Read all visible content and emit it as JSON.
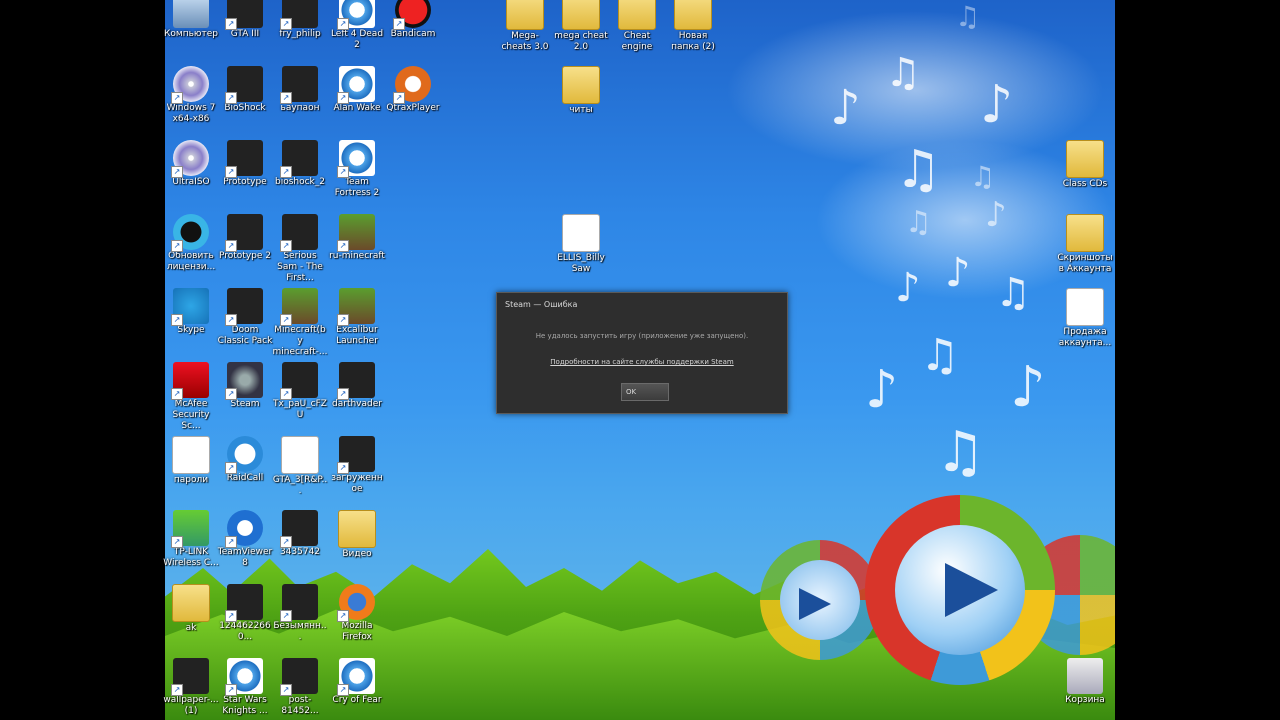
{
  "icons": [
    {
      "label": "Компьютер",
      "icon": "computer-icon"
    },
    {
      "label": "GTA III",
      "icon": "game-icon"
    },
    {
      "label": "fry_philip",
      "icon": "image-icon"
    },
    {
      "label": "Left 4 Dead 2",
      "icon": "internet-shortcut-icon"
    },
    {
      "label": "Bandicam",
      "icon": "bandicam-icon"
    },
    {
      "label": "Mega-cheats 3.0",
      "icon": "folder-icon"
    },
    {
      "label": "mega cheat 2.0",
      "icon": "folder-icon"
    },
    {
      "label": "Cheat engine",
      "icon": "folder-icon"
    },
    {
      "label": "Новая папка (2)",
      "icon": "folder-icon"
    },
    {
      "label": "Windows 7 x64-x86",
      "icon": "disc-icon"
    },
    {
      "label": "BioShock",
      "icon": "game-icon"
    },
    {
      "label": "ьаупаон",
      "icon": "image-icon"
    },
    {
      "label": "Alan Wake",
      "icon": "internet-shortcut-icon"
    },
    {
      "label": "QtraxPlayer",
      "icon": "qtrax-icon"
    },
    {
      "label": "читы",
      "icon": "folder-icon"
    },
    {
      "label": "UltraISO",
      "icon": "disc-icon"
    },
    {
      "label": "Prototype",
      "icon": "game-icon"
    },
    {
      "label": "bioshock_2",
      "icon": "image-icon"
    },
    {
      "label": "Team Fortress 2",
      "icon": "internet-shortcut-icon"
    },
    {
      "label": "Class CDs",
      "icon": "folder-icon"
    },
    {
      "label": "Обновить лицензи...",
      "icon": "update-icon"
    },
    {
      "label": "Prototype 2",
      "icon": "game-icon"
    },
    {
      "label": "Serious Sam - The First...",
      "icon": "game-icon"
    },
    {
      "label": "ru-minecraft",
      "icon": "minecraft-icon"
    },
    {
      "label": "ELLIS_Billy Saw",
      "icon": "document-icon"
    },
    {
      "label": "Скриншоты в Аккаунта",
      "icon": "folder-icon"
    },
    {
      "label": "Skype",
      "icon": "skype-icon"
    },
    {
      "label": "Doom Classic Pack",
      "icon": "game-icon"
    },
    {
      "label": "Minecraft(by minecraft-...",
      "icon": "minecraft-icon"
    },
    {
      "label": "Excalibur Launcher",
      "icon": "minecraft-icon"
    },
    {
      "label": "Продажа аккаунта...",
      "icon": "word-doc-icon"
    },
    {
      "label": "McAfee Security Sc...",
      "icon": "mcafee-icon"
    },
    {
      "label": "Steam",
      "icon": "steam-icon"
    },
    {
      "label": "Tx_paU_cFZU",
      "icon": "image-icon"
    },
    {
      "label": "darthvader",
      "icon": "image-icon"
    },
    {
      "label": "пароли",
      "icon": "word-doc-icon"
    },
    {
      "label": "RaidCall",
      "icon": "raidcall-icon"
    },
    {
      "label": "GTA_3[R&P...",
      "icon": "document-icon"
    },
    {
      "label": "загруженное",
      "icon": "image-icon"
    },
    {
      "label": "TP-LINK Wireless C...",
      "icon": "wifi-icon"
    },
    {
      "label": "TeamViewer 8",
      "icon": "teamviewer-icon"
    },
    {
      "label": "3435742",
      "icon": "image-icon"
    },
    {
      "label": "Видео",
      "icon": "folder-icon"
    },
    {
      "label": "ak",
      "icon": "folder-icon"
    },
    {
      "label": "1244622660...",
      "icon": "image-icon"
    },
    {
      "label": "Безымянн...",
      "icon": "image-icon"
    },
    {
      "label": "Mozilla Firefox",
      "icon": "firefox-icon"
    },
    {
      "label": "wallpaper-... (1)",
      "icon": "image-icon"
    },
    {
      "label": "Star Wars Knights ...",
      "icon": "internet-shortcut-icon"
    },
    {
      "label": "post-81452...",
      "icon": "image-icon"
    },
    {
      "label": "Cry of Fear",
      "icon": "internet-shortcut-icon"
    },
    {
      "label": "Корзина",
      "icon": "recycle-bin-icon"
    }
  ],
  "dialog": {
    "title": "Steam — Ошибка",
    "message": "Не удалось запустить игру (приложение уже запущено).",
    "link": "Подробности на сайте службы поддержки Steam",
    "ok_label": "OK"
  }
}
